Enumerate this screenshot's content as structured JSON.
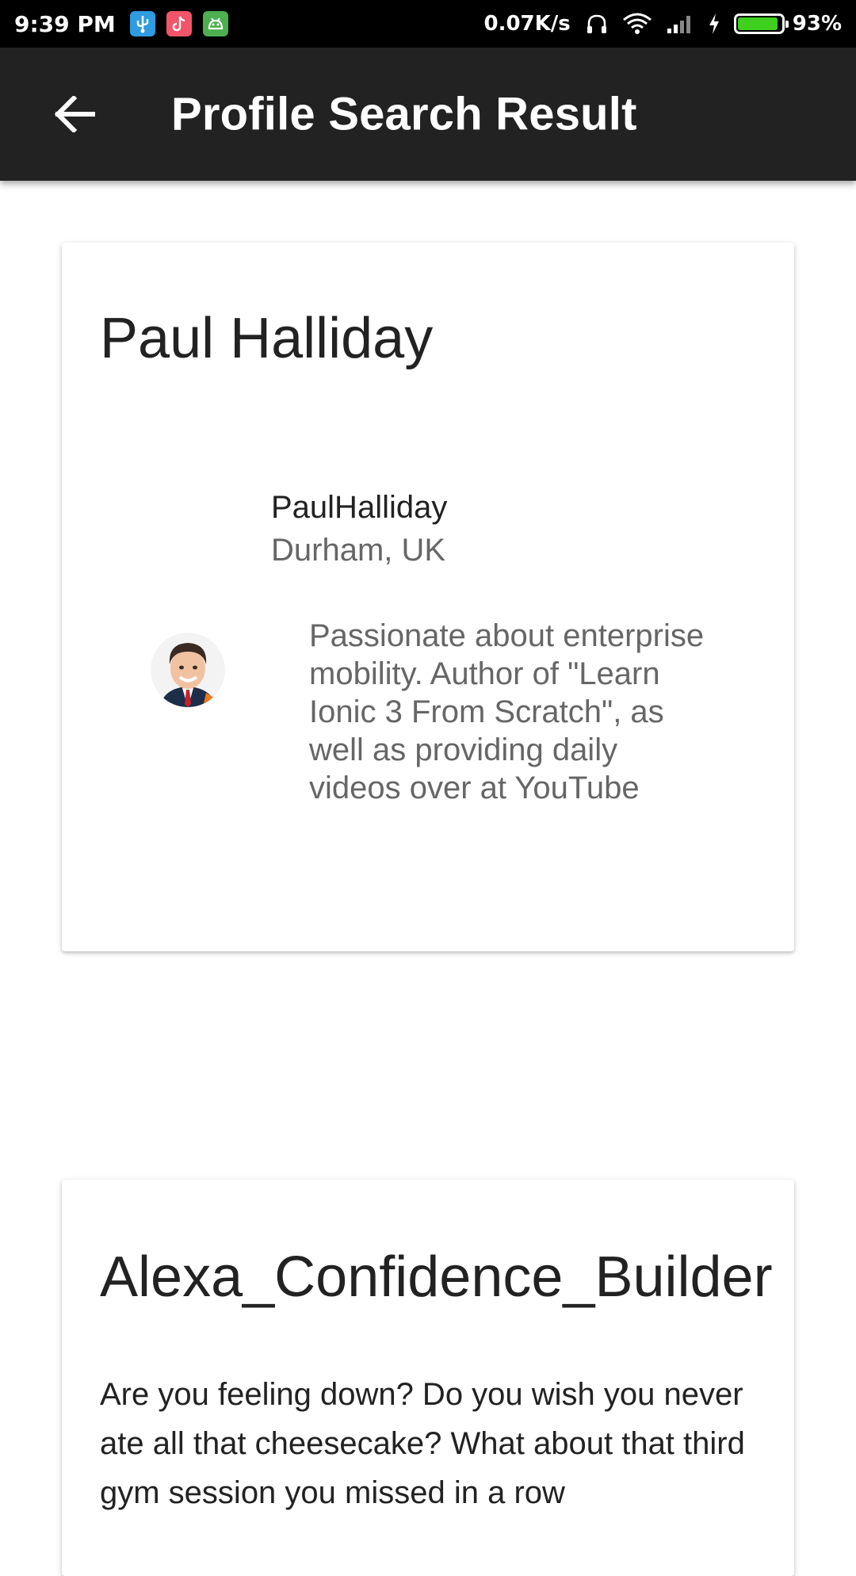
{
  "status_bar": {
    "time": "9:39 PM",
    "net_speed": "0.07K/s",
    "battery_pct": "93%",
    "battery_level": 0.93,
    "app_icons": [
      "usb-icon",
      "tiktok-icon",
      "android-icon"
    ],
    "colors": {
      "usb": "#2f9be0",
      "tiktok": "#f2546a",
      "android": "#4caf50"
    }
  },
  "app_bar": {
    "title": "Profile Search Result",
    "background": "#222222"
  },
  "results": [
    {
      "title": "Paul Halliday",
      "handle": "PaulHalliday",
      "location": "Durham, UK",
      "bio": "Passionate about enterprise mobility. Author of \"Learn Ionic 3 From Scratch\", as well as providing daily videos over at YouTube"
    },
    {
      "title": "Alexa_Confidence_Builder",
      "description": "Are you feeling down? Do you wish you never ate all that cheesecake? What about that third gym session you missed in a row"
    }
  ]
}
